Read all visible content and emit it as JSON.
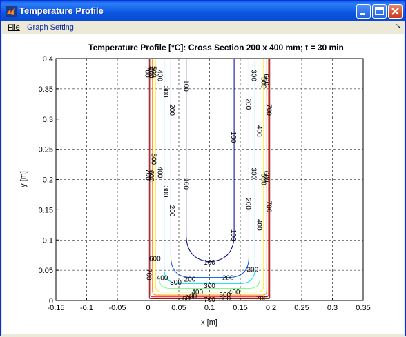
{
  "window": {
    "title": "Temperature Profile"
  },
  "menu": {
    "items": [
      "File",
      "Graph Setting"
    ]
  },
  "chart_data": {
    "type": "contour",
    "title": "Temperature Profile [°C]: Cross Section 200 x 400 mm; t = 30 min",
    "xlabel": "x [m]",
    "ylabel": "y [m]",
    "xlim": [
      -0.15,
      0.35
    ],
    "ylim": [
      0,
      0.4
    ],
    "grid": true,
    "x_ticks": [
      "-0.15",
      "-0.1",
      "-0.05",
      "0",
      "0.05",
      "0.1",
      "0.15",
      "0.2",
      "0.25",
      "0.3",
      "0.35"
    ],
    "y_ticks": [
      "0",
      "0.05",
      "0.1",
      "0.15",
      "0.2",
      "0.25",
      "0.3",
      "0.35",
      "0.4"
    ],
    "contour_levels": [
      {
        "value": 100,
        "color": "#00008f"
      },
      {
        "value": 200,
        "color": "#0050ff"
      },
      {
        "value": 300,
        "color": "#00dfff"
      },
      {
        "value": 400,
        "color": "#7fff7f"
      },
      {
        "value": 500,
        "color": "#ffef00"
      },
      {
        "value": 600,
        "color": "#ff7f00"
      },
      {
        "value": 700,
        "color": "#ef0000"
      },
      {
        "value": 800,
        "color": "#7f0000"
      }
    ],
    "contours": [
      {
        "level": 800,
        "x_left": 0.002,
        "x_right": 0.198,
        "y_bottom": 0.003,
        "r": 0.002
      },
      {
        "level": 700,
        "x_left": 0.004,
        "x_right": 0.196,
        "y_bottom": 0.006,
        "r": 0.004
      },
      {
        "level": 600,
        "x_left": 0.007,
        "x_right": 0.193,
        "y_bottom": 0.009,
        "r": 0.007
      },
      {
        "level": 500,
        "x_left": 0.012,
        "x_right": 0.188,
        "y_bottom": 0.014,
        "r": 0.011
      },
      {
        "level": 400,
        "x_left": 0.018,
        "x_right": 0.182,
        "y_bottom": 0.02,
        "r": 0.017
      },
      {
        "level": 300,
        "x_left": 0.026,
        "x_right": 0.174,
        "y_bottom": 0.028,
        "r": 0.025
      },
      {
        "level": 200,
        "x_left": 0.037,
        "x_right": 0.164,
        "y_bottom": 0.038,
        "r": 0.034
      },
      {
        "level": 100,
        "x_left": 0.062,
        "x_right": 0.14,
        "y_bottom": 0.064,
        "r": 0.045
      }
    ],
    "labels": [
      {
        "text": "700",
        "x": 0.0,
        "y": 0.378,
        "rot": 90
      },
      {
        "text": "600",
        "x": 0.006,
        "y": 0.377,
        "rot": 90
      },
      {
        "text": "500",
        "x": 0.01,
        "y": 0.378,
        "rot": 90
      },
      {
        "text": "400",
        "x": 0.02,
        "y": 0.372,
        "rot": 90
      },
      {
        "text": "300",
        "x": 0.03,
        "y": 0.345,
        "rot": 90
      },
      {
        "text": "200",
        "x": 0.04,
        "y": 0.315,
        "rot": 90
      },
      {
        "text": "100",
        "x": 0.063,
        "y": 0.355,
        "rot": 90
      },
      {
        "text": "500",
        "x": 0.01,
        "y": 0.234,
        "rot": 90
      },
      {
        "text": "400",
        "x": 0.02,
        "y": 0.212,
        "rot": 90
      },
      {
        "text": "300",
        "x": 0.03,
        "y": 0.18,
        "rot": 90
      },
      {
        "text": "200",
        "x": 0.04,
        "y": 0.148,
        "rot": 90
      },
      {
        "text": "100",
        "x": 0.063,
        "y": 0.193,
        "rot": 90
      },
      {
        "text": "700",
        "x": 0.001,
        "y": 0.208,
        "rot": 90
      },
      {
        "text": "600",
        "x": 0.006,
        "y": 0.206,
        "rot": 90
      },
      {
        "text": "300",
        "x": 0.173,
        "y": 0.372,
        "rot": 90
      },
      {
        "text": "200",
        "x": 0.164,
        "y": 0.325,
        "rot": 90
      },
      {
        "text": "100",
        "x": 0.14,
        "y": 0.27,
        "rot": 90
      },
      {
        "text": "400",
        "x": 0.182,
        "y": 0.28,
        "rot": 90
      },
      {
        "text": "500",
        "x": 0.189,
        "y": 0.36,
        "rot": 90
      },
      {
        "text": "600",
        "x": 0.193,
        "y": 0.365,
        "rot": 90
      },
      {
        "text": "700",
        "x": 0.198,
        "y": 0.315,
        "rot": 90
      },
      {
        "text": "300",
        "x": 0.173,
        "y": 0.21,
        "rot": 90
      },
      {
        "text": "200",
        "x": 0.164,
        "y": 0.16,
        "rot": 90
      },
      {
        "text": "100",
        "x": 0.14,
        "y": 0.108,
        "rot": 90
      },
      {
        "text": "400",
        "x": 0.182,
        "y": 0.125,
        "rot": 90
      },
      {
        "text": "500",
        "x": 0.189,
        "y": 0.2,
        "rot": 90
      },
      {
        "text": "600",
        "x": 0.193,
        "y": 0.205,
        "rot": 90
      },
      {
        "text": "700",
        "x": 0.198,
        "y": 0.155,
        "rot": 90
      },
      {
        "text": "700",
        "x": 0.002,
        "y": 0.043,
        "rot": 90
      },
      {
        "text": "600",
        "x": 0.011,
        "y": 0.07,
        "rot": 0
      },
      {
        "text": "400",
        "x": 0.023,
        "y": 0.038,
        "rot": 0
      },
      {
        "text": "300",
        "x": 0.045,
        "y": 0.031,
        "rot": 0
      },
      {
        "text": "200",
        "x": 0.068,
        "y": 0.036,
        "rot": 0
      },
      {
        "text": "100",
        "x": 0.1,
        "y": 0.064,
        "rot": 0
      },
      {
        "text": "300",
        "x": 0.1,
        "y": 0.025,
        "rot": 0
      },
      {
        "text": "200",
        "x": 0.13,
        "y": 0.038,
        "rot": 0
      },
      {
        "text": "300",
        "x": 0.17,
        "y": 0.052,
        "rot": 0
      },
      {
        "text": "400",
        "x": 0.14,
        "y": 0.015,
        "rot": 0
      },
      {
        "text": "500",
        "x": 0.125,
        "y": 0.01,
        "rot": 0
      },
      {
        "text": "400",
        "x": 0.08,
        "y": 0.015,
        "rot": 0
      },
      {
        "text": "500",
        "x": 0.07,
        "y": 0.008,
        "rot": 0
      },
      {
        "text": "600",
        "x": 0.065,
        "y": 0.004,
        "rot": 0
      },
      {
        "text": "700",
        "x": 0.1,
        "y": 0.002,
        "rot": 0
      },
      {
        "text": "800",
        "x": 0.125,
        "y": 0.004,
        "rot": 0
      },
      {
        "text": "700",
        "x": 0.185,
        "y": 0.004,
        "rot": 0
      }
    ]
  }
}
